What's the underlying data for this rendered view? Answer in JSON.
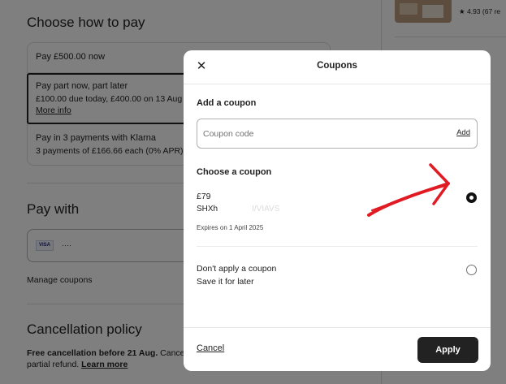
{
  "payment": {
    "title": "Choose how to pay",
    "options": [
      {
        "label": "Pay £500.00 now"
      },
      {
        "label": "Pay part now, part later",
        "detail": "£100.00 due today, £400.00 on 13 Aug",
        "link": "More info"
      },
      {
        "label": "Pay in 3 payments with Klarna",
        "detail": "3 payments of £166.66 each (0% APR)"
      }
    ]
  },
  "pay_with": {
    "title": "Pay with",
    "card_brand": "VISA",
    "card_mask": "····",
    "manage_link": "Manage coupons"
  },
  "cancellation": {
    "title": "Cancellation policy",
    "bold_text": "Free cancellation before 21 Aug.",
    "text": " Cance",
    "text2": "partial refund.",
    "link": "Learn more"
  },
  "listing": {
    "rating": "★ 4.93 (67 re"
  },
  "modal": {
    "title": "Coupons",
    "close_icon": "close-icon",
    "add_section": {
      "label": "Add a coupon",
      "placeholder": "Coupon code",
      "add_label": "Add"
    },
    "choose_section": {
      "label": "Choose a coupon",
      "coupons": [
        {
          "amount": "£79",
          "code": "SHXh",
          "code_tail": "I/VIAVS",
          "expiry": "Expires on 1 April 2025",
          "selected": true
        },
        {
          "title": "Don't apply a coupon",
          "subtitle": "Save it for later",
          "selected": false
        }
      ]
    },
    "footer": {
      "cancel_label": "Cancel",
      "apply_label": "Apply"
    }
  },
  "colors": {
    "annotation_arrow": "#e01b24",
    "primary_button": "#222222",
    "overlay": "rgba(0,0,0,0.5)"
  }
}
